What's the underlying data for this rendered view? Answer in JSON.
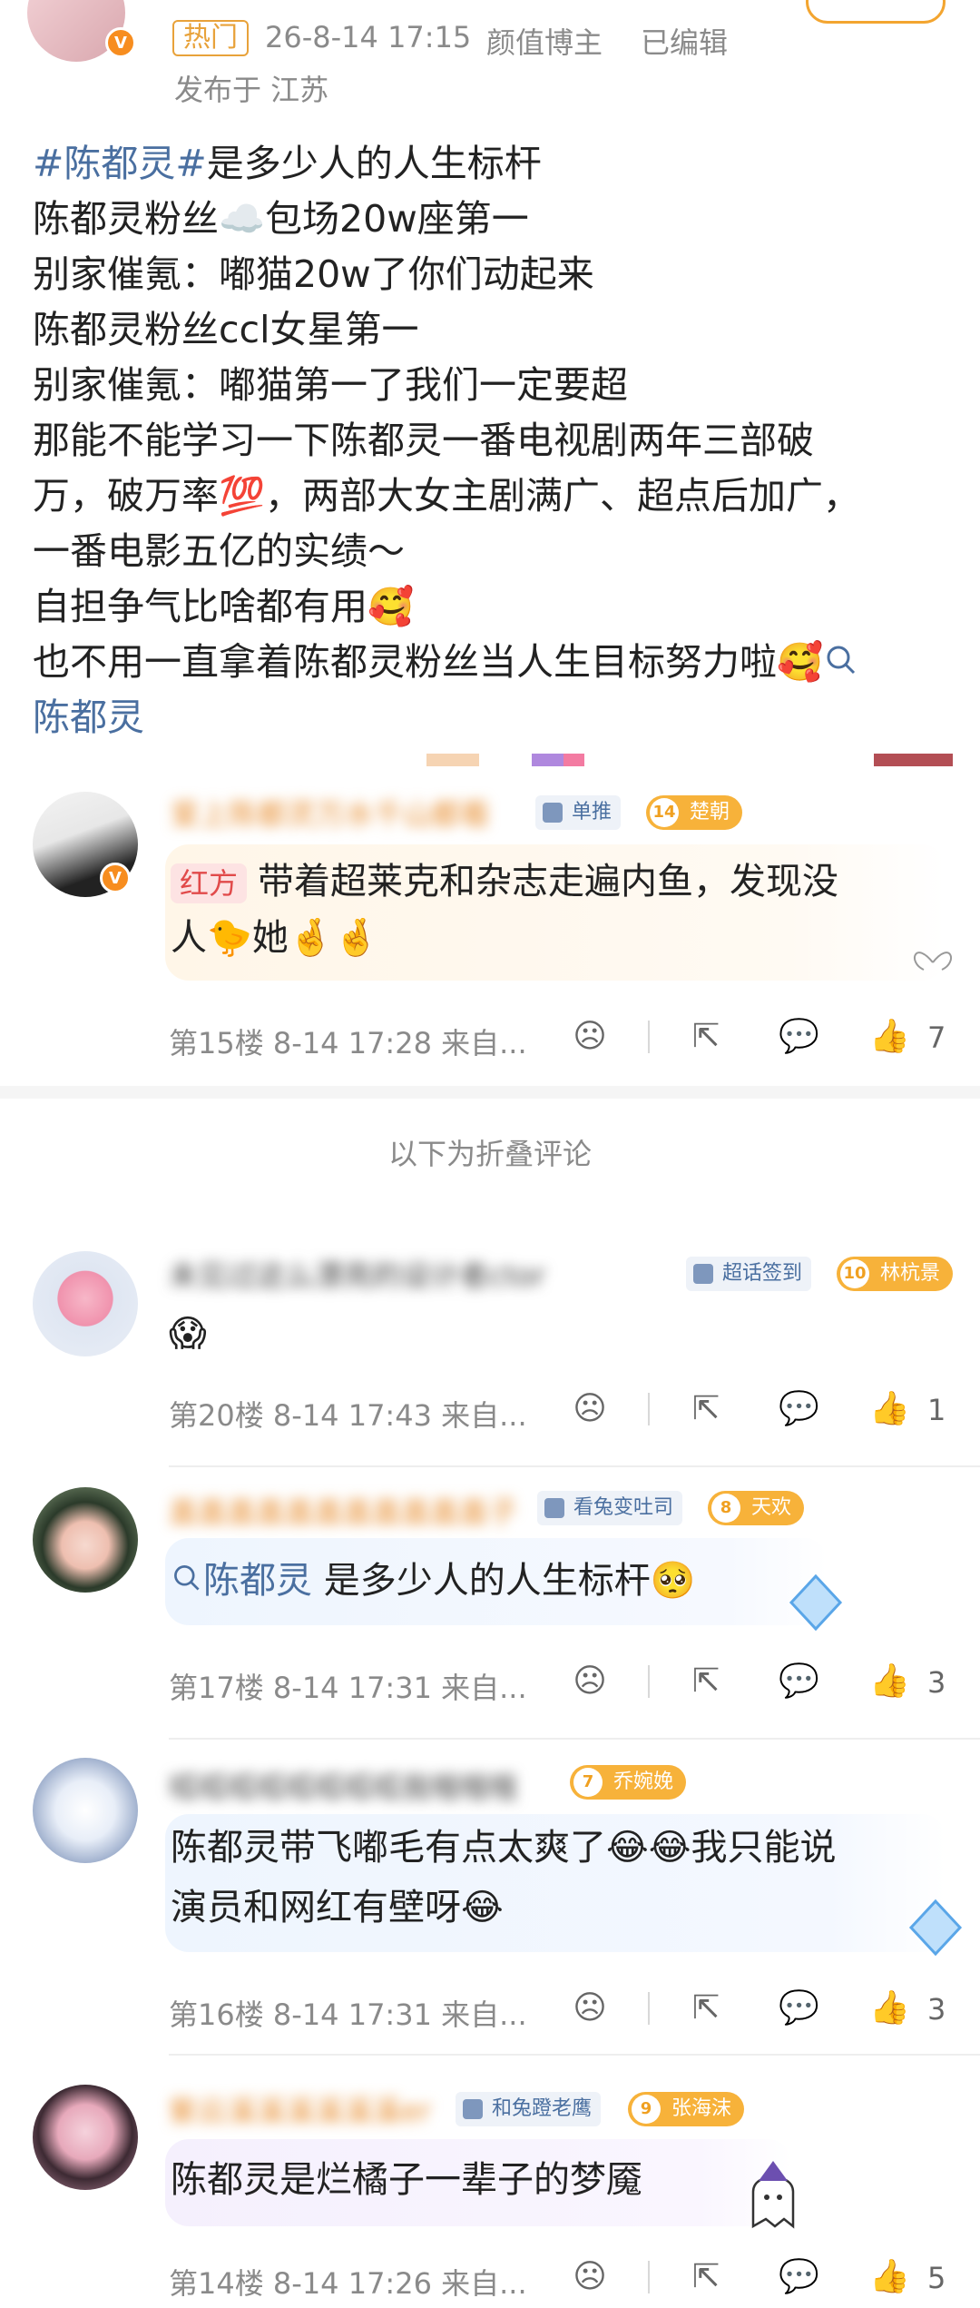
{
  "post": {
    "hot_tag": "热门",
    "time": "26-8-14 17:15",
    "author_tag": "颜值博主",
    "edited": "已编辑",
    "location": "发布于 江苏",
    "lines": [
      {
        "hashtag": "#陈都灵#",
        "text": "是多少人的人生标杆"
      },
      {
        "text": "陈都灵粉丝☁️包场20w座第一"
      },
      {
        "text": "别家催氪：嘟猫20w了你们动起来"
      },
      {
        "text": "陈都灵粉丝ccl女星第一"
      },
      {
        "text": "别家催氪：嘟猫第一了我们一定要超"
      },
      {
        "text": "那能不能学习一下陈都灵一番电视剧两年三部破"
      },
      {
        "text": "万，破万率💯，两部大女主剧满广、超点后加广，"
      },
      {
        "text": "一番电影五亿的实绩～"
      },
      {
        "text": "自担争气比啥都有用🥰"
      },
      {
        "text": "也不用一直拿着陈都灵粉丝当人生目标努力啦🥰"
      },
      {
        "link": "陈都灵"
      }
    ]
  },
  "fold_divider": "以下为折叠评论",
  "comments": [
    {
      "name": "爱上陈都灵万水千山都看",
      "badge": "单推",
      "level": "14",
      "level_name": "楚朝",
      "tag": "红方",
      "text_lines": [
        "带着超莱克和杂志走遍内鱼，发现没",
        "人🐤她🤞🤞"
      ],
      "floor": "第15楼",
      "time": "8-14 17:28",
      "source": "来自...",
      "likes": "7"
    },
    {
      "name": "未见过这么漂亮的设计者ctor",
      "badge": "超话签到",
      "level": "10",
      "level_name": "林杭景",
      "text_lines": [
        "😱"
      ],
      "floor": "第20楼",
      "time": "8-14 17:43",
      "source": "来自...",
      "likes": "1"
    },
    {
      "name": "盖盖盖盖盖盖盖盖盖盖盖子",
      "badge": "看兔变吐司",
      "level": "8",
      "level_name": "天欢",
      "link": "陈都灵",
      "text_lines": [
        "是多少人的人生标杆🥺"
      ],
      "floor": "第17楼",
      "time": "8-14 17:31",
      "source": "来自...",
      "likes": "3"
    },
    {
      "name": "呱呱呱呱呱呱呱呱我哦哦哦",
      "level": "7",
      "level_name": "乔婉娩",
      "text_lines": [
        "陈都灵带飞嘟毛有点太爽了😂😂我只能说",
        "演员和网红有壁呀😂"
      ],
      "floor": "第16楼",
      "time": "8-14 17:31",
      "source": "来自...",
      "likes": "3"
    },
    {
      "name": "紫云溪溪溪溪溪溪er",
      "badge": "和兔蹬老鹰",
      "level": "9",
      "level_name": "张海沫",
      "text_lines": [
        "陈都灵是烂橘子一辈子的梦魇"
      ],
      "floor": "第14楼",
      "time": "8-14 17:26",
      "source": "来自...",
      "likes": "5"
    }
  ],
  "colors": {
    "accent_orange": "#f3a530",
    "link_blue": "#4a6fa0",
    "meta_gray": "#8a8a8a",
    "red_tag": "#e14a4a"
  }
}
